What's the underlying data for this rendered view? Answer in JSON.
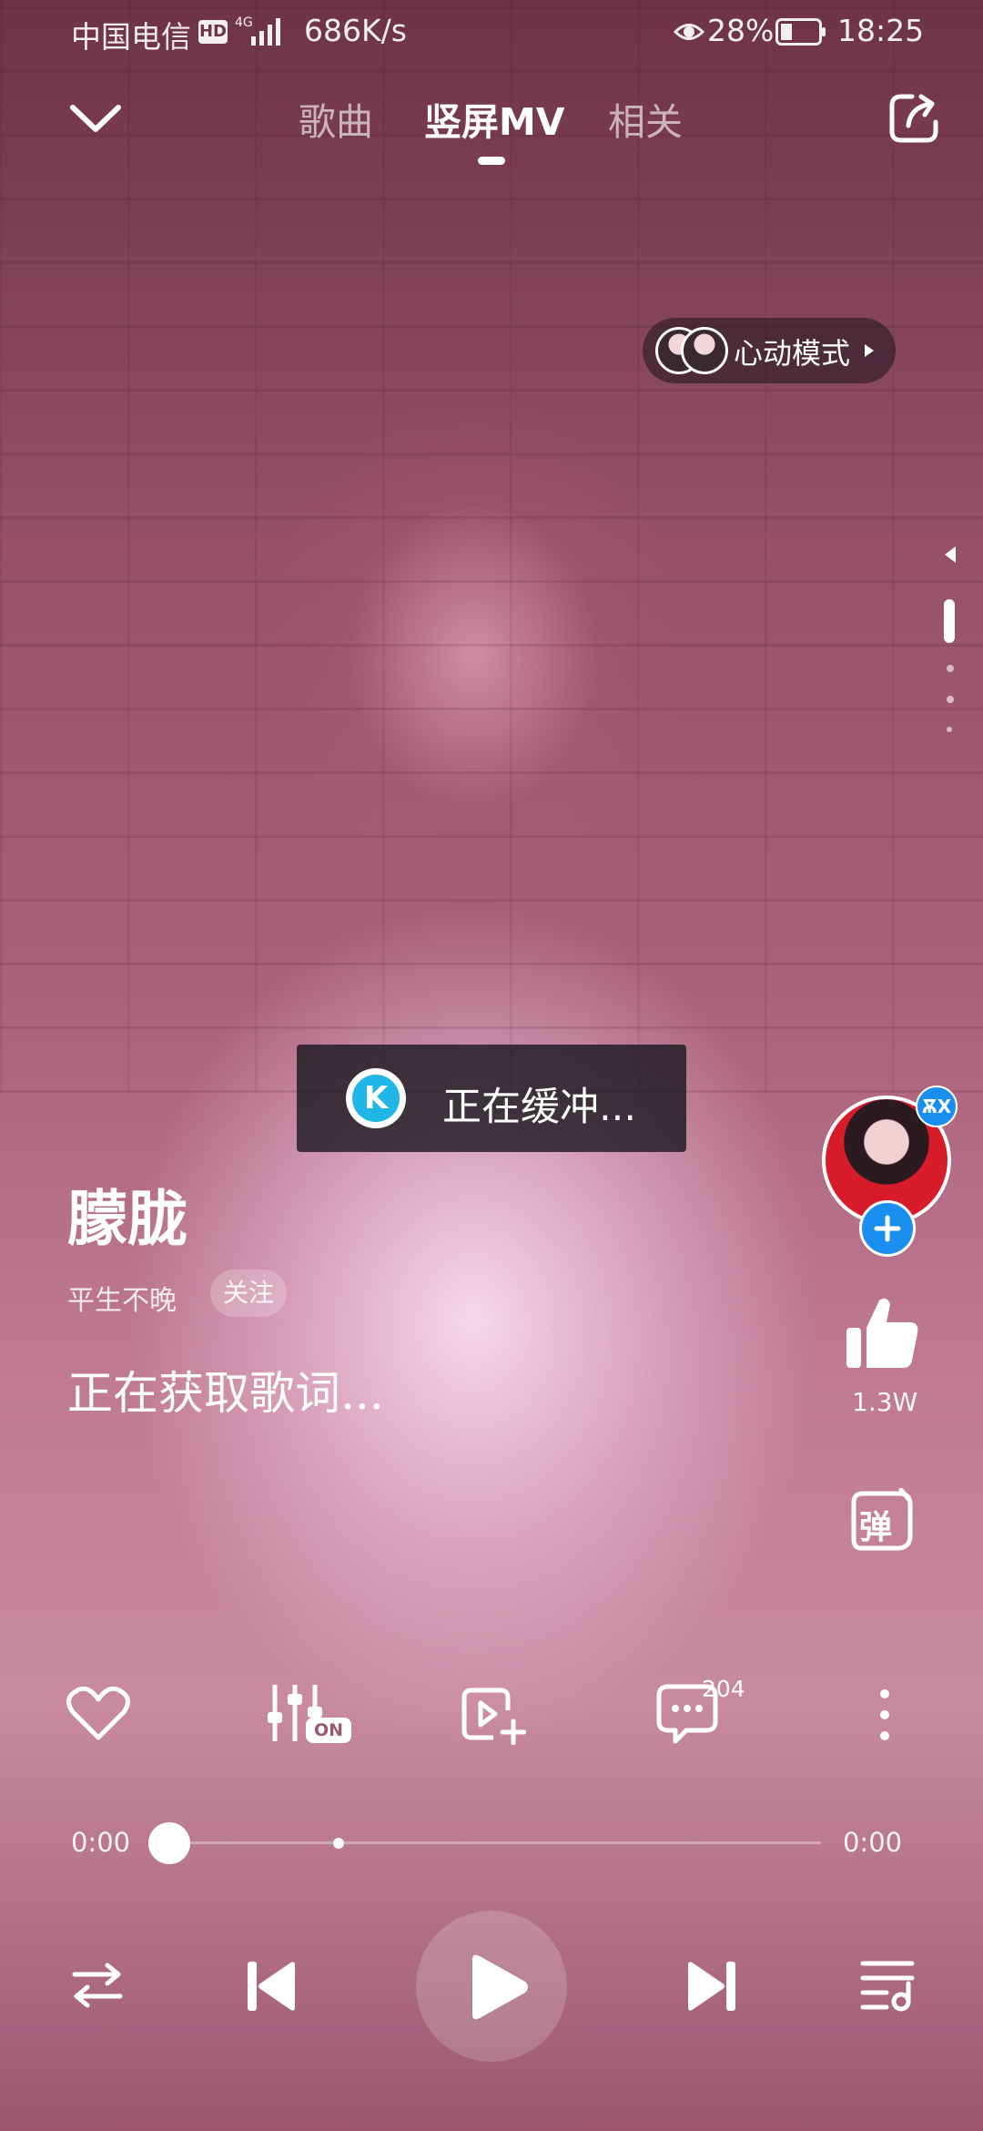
{
  "status_bar": {
    "carrier": "中国电信",
    "hd_badge": "HD",
    "network_type": "4G",
    "speed": "686K/s",
    "battery": "28%",
    "time": "18:25"
  },
  "top_bar": {
    "tabs": [
      {
        "label": "歌曲",
        "active": false
      },
      {
        "label": "竖屏MV",
        "active": true
      },
      {
        "label": "相关",
        "active": false
      }
    ]
  },
  "heart_mode": {
    "label": "心动模式"
  },
  "buffering": {
    "text": "正在缓冲...",
    "logo_letter": "K"
  },
  "song": {
    "title": "朦胧",
    "artist": "平生不晚",
    "follow_label": "关注",
    "lyrics_status": "正在获取歌词..."
  },
  "side_actions": {
    "like_count": "1.3W",
    "danmaku_label": "弹"
  },
  "action_row": {
    "sound_effect_badge": "ON",
    "comment_count": "204"
  },
  "progress": {
    "current_time": "0:00",
    "total_time": "0:00",
    "fraction": 0.0
  },
  "colors": {
    "accent_blue": "#1b8ff0",
    "buffer_logo": "#20b6e6"
  },
  "icons": [
    "chevron-down-icon",
    "share-icon",
    "heart-icon",
    "equalizer-icon",
    "play-video-add-icon",
    "comment-icon",
    "more-icon",
    "repeat-icon",
    "previous-icon",
    "play-icon",
    "next-icon",
    "playlist-icon",
    "thumb-up-icon",
    "danmaku-icon"
  ]
}
